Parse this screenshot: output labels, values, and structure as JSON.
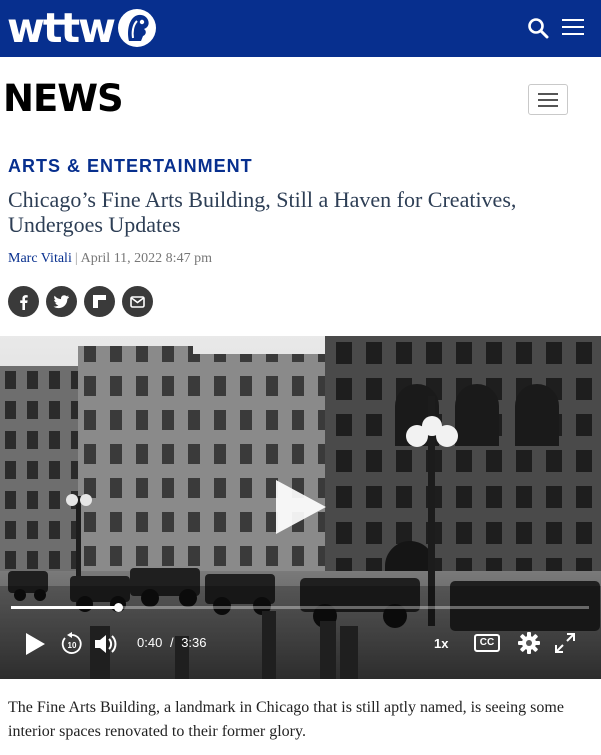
{
  "site": {
    "logo_text": "wttw",
    "logo_icon": "pbs-head-icon"
  },
  "topbar": {
    "search_icon": "search-icon",
    "menu_icon": "hamburger-menu-icon",
    "bg_color": "#072f8e"
  },
  "section": {
    "title": "NEWS",
    "menu_icon": "hamburger-menu-icon"
  },
  "article": {
    "category": "ARTS & ENTERTAINMENT",
    "headline": "Chicago’s Fine Arts Building, Still a Haven for Creatives, Undergoes Updates",
    "author": "Marc Vitali",
    "separator": "|",
    "date": "April 11, 2022 8:47 pm",
    "summary": "The Fine Arts Building, a landmark in Chicago that is still aptly named, is seeing some interior spaces renovated to their former glory."
  },
  "share": [
    {
      "name": "facebook-icon"
    },
    {
      "name": "twitter-icon"
    },
    {
      "name": "flipboard-icon"
    },
    {
      "name": "email-icon"
    }
  ],
  "video": {
    "current_time": "0:40",
    "time_separator": "/",
    "duration": "3:36",
    "progress": 0.185,
    "speed": "1x",
    "cc_label": "CC"
  }
}
